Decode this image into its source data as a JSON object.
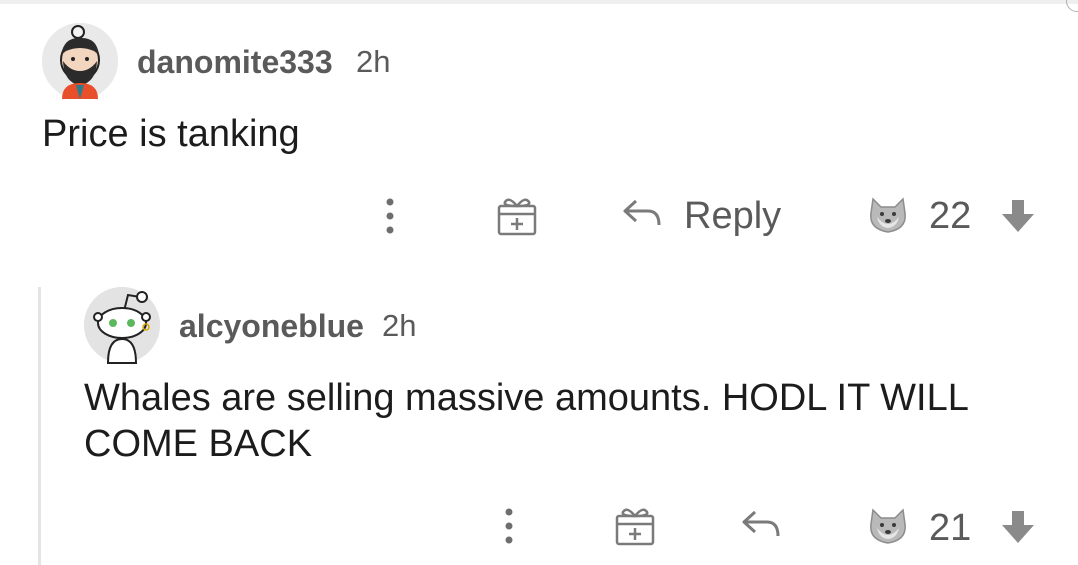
{
  "comments": [
    {
      "username": "danomite333",
      "age": "2h",
      "text": "Price is tanking",
      "reply_label": "Reply",
      "score": "22",
      "avatar": "bearded-snoo-avatar"
    },
    {
      "username": "alcyoneblue",
      "age": "2h",
      "text": "Whales are selling massive amounts. HODL IT WILL COME BACK",
      "score": "21",
      "avatar": "default-snoo-avatar"
    }
  ],
  "icons": {
    "more": "more-vertical-icon",
    "award": "gift-award-icon",
    "reply": "reply-arrow-icon",
    "upvote": "doge-upvote-icon",
    "downvote": "downvote-arrow-icon"
  },
  "colors": {
    "text": "#1c1c1c",
    "meta": "#5a5a5a",
    "icon": "#8a8a8a",
    "thread_line": "#e4e4e4"
  }
}
